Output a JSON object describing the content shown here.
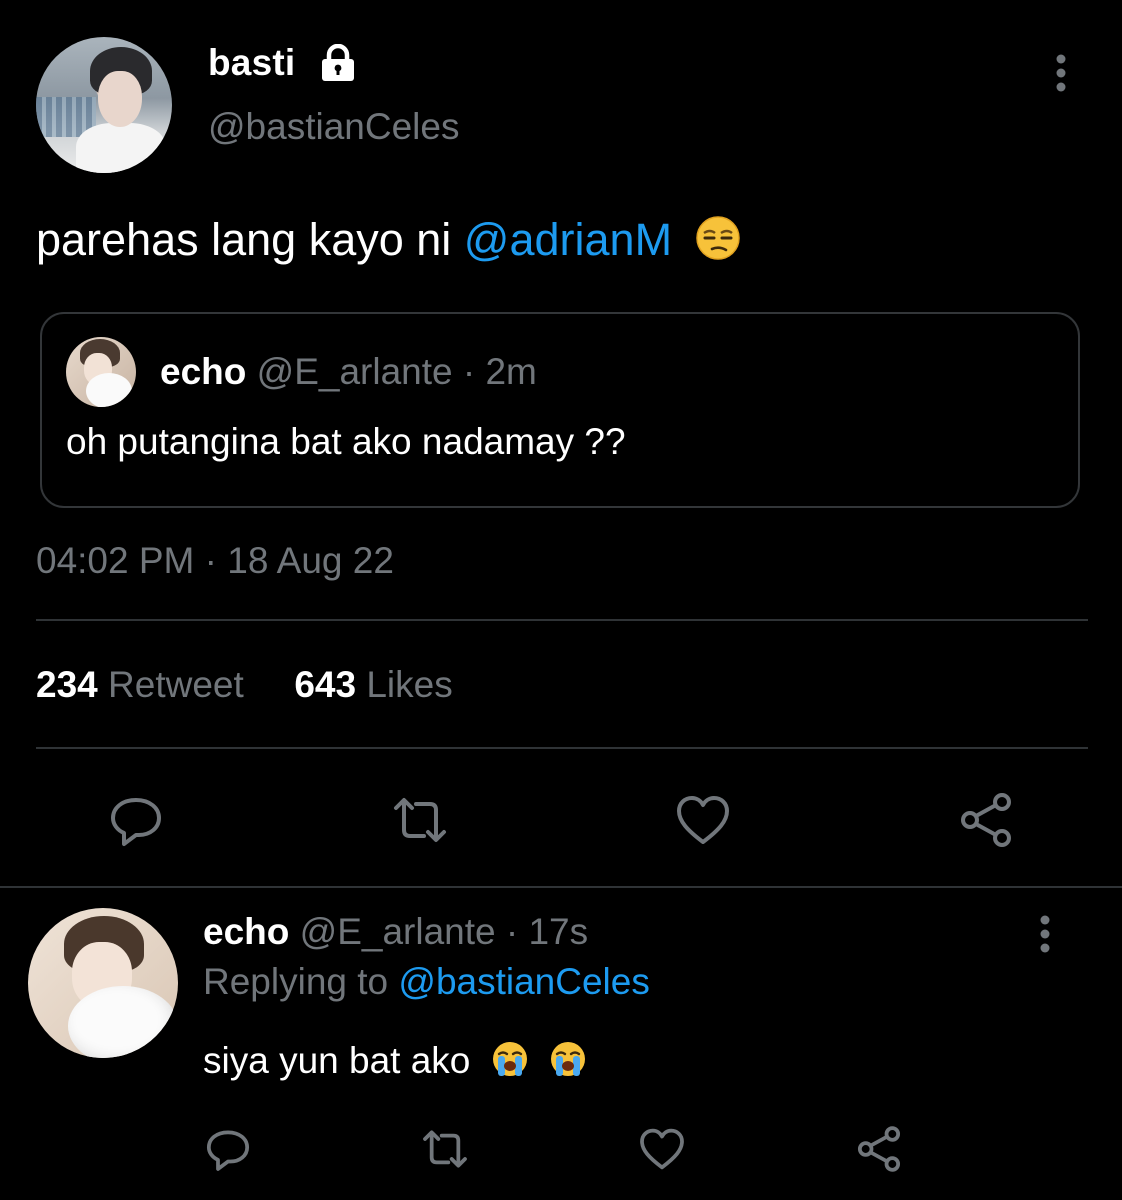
{
  "tweet": {
    "author_name": "basti",
    "author_handle": "@bastianCeles",
    "text_prefix": "parehas lang kayo ni ",
    "mention": "@adrianM",
    "emoji": "😒",
    "timestamp": "04:02 PM · 18 Aug 22",
    "retweet_count": "234",
    "retweet_label": "Retweet",
    "likes_count": "643",
    "likes_label": "Likes"
  },
  "quoted_tweet": {
    "author_name": "echo",
    "author_handle": "@E_arlante",
    "time": "· 2m",
    "text": "oh putangina bat ako nadamay ??"
  },
  "reply": {
    "author_name": "echo",
    "author_handle": "@E_arlante",
    "time": "· 17s",
    "replying_label": "Replying to",
    "replying_handle": "@bastianCeles",
    "text": "siya yun bat ako",
    "emojis": [
      "😭",
      "😭"
    ]
  },
  "icons": {
    "lock": "lock-icon",
    "more": "more-vertical-icon",
    "reply": "reply-icon",
    "retweet": "retweet-icon",
    "like": "heart-icon",
    "share": "share-icon"
  },
  "colors": {
    "background": "#000000",
    "text": "#ffffff",
    "muted": "#71767b",
    "link": "#1d9bf0",
    "divider": "#2f3336"
  }
}
